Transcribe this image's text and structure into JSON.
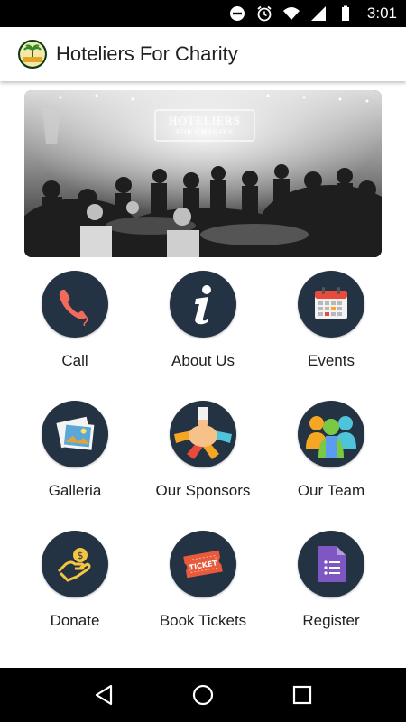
{
  "status_bar": {
    "time": "3:01",
    "icons": [
      "do-not-disturb-icon",
      "alarm-icon",
      "wifi-icon",
      "signal-icon",
      "battery-icon"
    ]
  },
  "app_bar": {
    "title": "Hoteliers For Charity",
    "logo": "hoteliers-for-charity-logo"
  },
  "banner": {
    "sign_text": "HOTELIERS",
    "sign_subtext": "FOR CHARITY"
  },
  "menu": {
    "items": [
      {
        "label": "Call",
        "icon": "phone-icon"
      },
      {
        "label": "About Us",
        "icon": "info-icon"
      },
      {
        "label": "Events",
        "icon": "calendar-icon"
      },
      {
        "label": "Galleria",
        "icon": "photos-icon"
      },
      {
        "label": "Our Sponsors",
        "icon": "hands-together-icon"
      },
      {
        "label": "Our Team",
        "icon": "team-icon"
      },
      {
        "label": "Donate",
        "icon": "donate-icon"
      },
      {
        "label": "Book Tickets",
        "icon": "ticket-icon"
      },
      {
        "label": "Register",
        "icon": "form-icon"
      }
    ]
  },
  "ticket_text": "TICKET",
  "nav_bar": {
    "buttons": [
      "back-icon",
      "home-icon",
      "recents-icon"
    ]
  },
  "colors": {
    "icon_circle": "#233343",
    "status_bar": "#000000",
    "nav_bar": "#000000"
  }
}
